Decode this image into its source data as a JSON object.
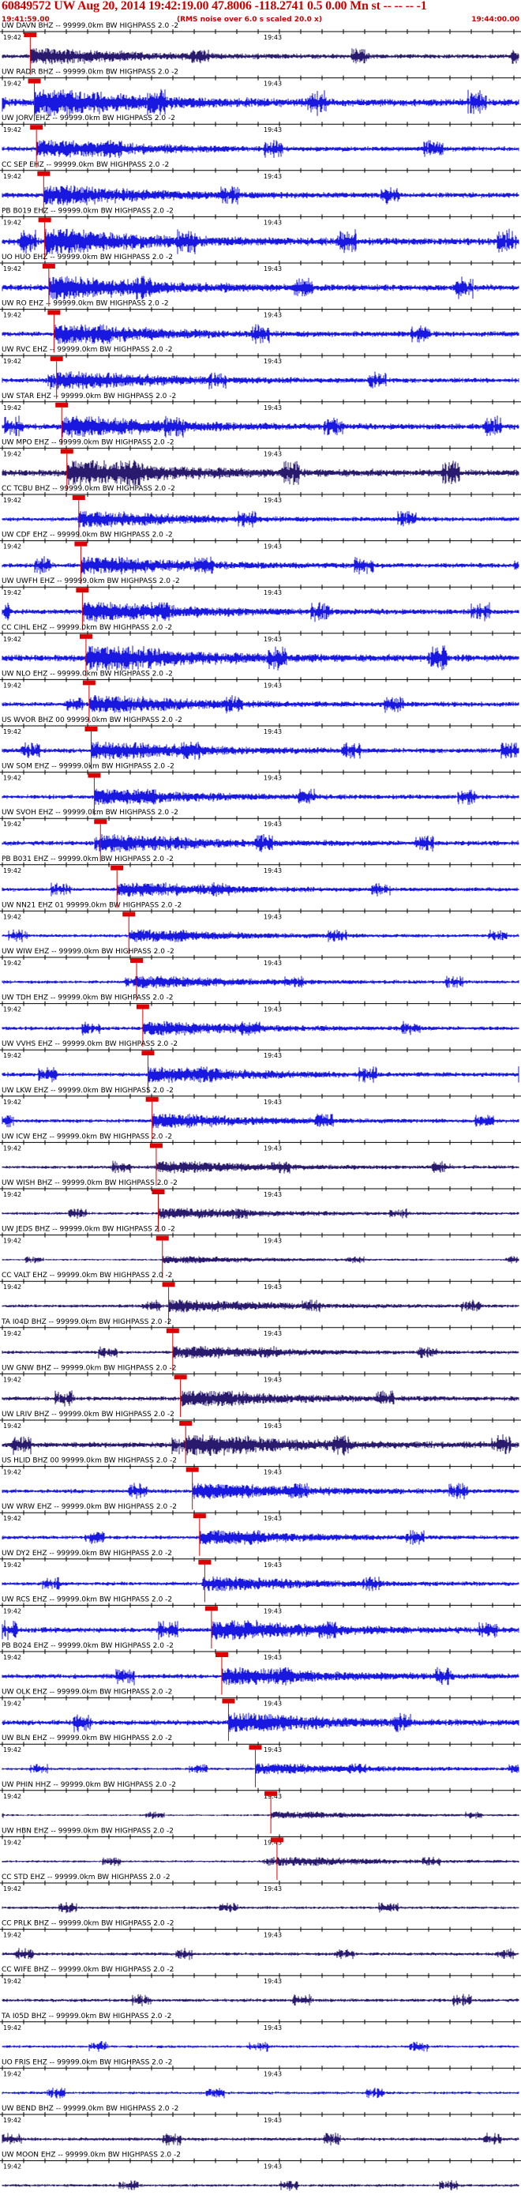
{
  "header": {
    "title": "60849572 UW Aug 20, 2014 19:42:19.00   47.8006 -118.2741  0.5 0.00 Mn st -- -- --  -1",
    "start_time": "19:41:59.00",
    "note": "(RMS noise over 6.0 s scaled 20.0 x)",
    "end_time": "19:44:00.00"
  },
  "time_labels": {
    "left": "19:42",
    "mid": "19:43"
  },
  "colors": {
    "trace_blue": "#1818e0",
    "trace_dark": "#2a1a6e",
    "pick_red": "#dd0000",
    "axis": "#000000"
  },
  "stations": [
    {
      "label": "UW DAVN BHZ -- 99999.0km BW  HIGHPASS  2.0 -2",
      "pick": 0.054,
      "amp": 0.45,
      "dark": true
    },
    {
      "label": "UW RADR BHZ -- 99999.0km BW  HIGHPASS  2.0 -2",
      "pick": 0.062,
      "amp": 0.75,
      "dark": false
    },
    {
      "label": "UW JORV EHZ -- 99999.0km BW  HIGHPASS  2.0 -2",
      "pick": 0.066,
      "amp": 0.5,
      "dark": false
    },
    {
      "label": "CC SEP EHZ -- 99999.0km BW  HIGHPASS  2.0 -2",
      "pick": 0.08,
      "amp": 0.55,
      "dark": false
    },
    {
      "label": "PB B019 EHZ -- 99999.0km BW  HIGHPASS  2.0 -2",
      "pick": 0.082,
      "amp": 0.7,
      "dark": false
    },
    {
      "label": "UO HUO EHZ -- 99999.0km BW  HIGHPASS  2.0 -2",
      "pick": 0.09,
      "amp": 0.65,
      "dark": false
    },
    {
      "label": "UW RO EHZ -- 99999.0km BW  HIGHPASS  2.0 -2",
      "pick": 0.1,
      "amp": 0.55,
      "dark": false
    },
    {
      "label": "UW RVC EHZ -- 99999.0km BW  HIGHPASS  2.0 -2",
      "pick": 0.105,
      "amp": 0.5,
      "dark": false
    },
    {
      "label": "UW STAR EHZ -- 99999.0km BW  HIGHPASS  2.0 -2",
      "pick": 0.115,
      "amp": 0.6,
      "dark": false
    },
    {
      "label": "UW MPO EHZ -- 99999.0km BW  HIGHPASS  2.0 -2",
      "pick": 0.125,
      "amp": 0.7,
      "dark": true
    },
    {
      "label": "CC TCBU BHZ -- 99999.0km BW  HIGHPASS  2.0 -2",
      "pick": 0.148,
      "amp": 0.45,
      "dark": false
    },
    {
      "label": "UW CDF EHZ -- 99999.0km BW  HIGHPASS  2.0 -2",
      "pick": 0.152,
      "amp": 0.5,
      "dark": false
    },
    {
      "label": "UW UWFH EHZ -- 99999.0km BW  HIGHPASS  2.0 -2",
      "pick": 0.155,
      "amp": 0.55,
      "dark": false
    },
    {
      "label": "CC CIHL EHZ -- 99999.0km BW  HIGHPASS  2.0 -2",
      "pick": 0.162,
      "amp": 0.7,
      "dark": false
    },
    {
      "label": "UW NLO EHZ -- 99999.0km BW  HIGHPASS  2.0 -2",
      "pick": 0.168,
      "amp": 0.5,
      "dark": false
    },
    {
      "label": "US WVOR BHZ 00 99999.0km BW  HIGHPASS  2.0 -2",
      "pick": 0.172,
      "amp": 0.5,
      "dark": false
    },
    {
      "label": "UW SOM EHZ -- 99999.0km BW  HIGHPASS  2.0 -2",
      "pick": 0.178,
      "amp": 0.45,
      "dark": false
    },
    {
      "label": "UW SVOH EHZ -- 99999.0km BW  HIGHPASS  2.0 -2",
      "pick": 0.19,
      "amp": 0.5,
      "dark": false
    },
    {
      "label": "PB B031 EHZ -- 99999.0km BW  HIGHPASS  2.0 -2",
      "pick": 0.222,
      "amp": 0.4,
      "dark": false
    },
    {
      "label": "UW NN21 EHZ 01 99999.0km BW  HIGHPASS  2.0 -2",
      "pick": 0.245,
      "amp": 0.35,
      "dark": false
    },
    {
      "label": "UW WIW EHZ -- 99999.0km BW  HIGHPASS  2.0 -2",
      "pick": 0.26,
      "amp": 0.35,
      "dark": false
    },
    {
      "label": "UW TDH EHZ -- 99999.0km BW  HIGHPASS  2.0 -2",
      "pick": 0.272,
      "amp": 0.4,
      "dark": false
    },
    {
      "label": "UW VVHS EHZ -- 99999.0km BW  HIGHPASS  2.0 -2",
      "pick": 0.282,
      "amp": 0.45,
      "dark": false
    },
    {
      "label": "UW LKW EHZ -- 99999.0km BW  HIGHPASS  2.0 -2",
      "pick": 0.29,
      "amp": 0.4,
      "dark": false
    },
    {
      "label": "UW ICW EHZ -- 99999.0km BW  HIGHPASS  2.0 -2",
      "pick": 0.298,
      "amp": 0.35,
      "dark": true
    },
    {
      "label": "UW WISH BHZ -- 99999.0km BW  HIGHPASS  2.0 -2",
      "pick": 0.302,
      "amp": 0.3,
      "dark": true
    },
    {
      "label": "UW JEDS BHZ -- 99999.0km BW  HIGHPASS  2.0 -2",
      "pick": 0.31,
      "amp": 0.2,
      "dark": true
    },
    {
      "label": "CC VALT EHZ -- 99999.0km BW  HIGHPASS  2.0 -2",
      "pick": 0.322,
      "amp": 0.35,
      "dark": true
    },
    {
      "label": "TA I04D BHZ -- 99999.0km BW  HIGHPASS  2.0 -2",
      "pick": 0.33,
      "amp": 0.35,
      "dark": true
    },
    {
      "label": "UW GNW BHZ -- 99999.0km BW  HIGHPASS  2.0 -2",
      "pick": 0.345,
      "amp": 0.45,
      "dark": true
    },
    {
      "label": "UW LRIV BHZ -- 99999.0km BW  HIGHPASS  2.0 -2",
      "pick": 0.355,
      "amp": 0.6,
      "dark": true
    },
    {
      "label": "US HLID BHZ 00 99999.0km BW  HIGHPASS  2.0 -2",
      "pick": 0.368,
      "amp": 0.45,
      "dark": false
    },
    {
      "label": "UW WRW EHZ -- 99999.0km BW  HIGHPASS  2.0 -2",
      "pick": 0.382,
      "amp": 0.4,
      "dark": false
    },
    {
      "label": "UW DY2 EHZ -- 99999.0km BW  HIGHPASS  2.0 -2",
      "pick": 0.392,
      "amp": 0.4,
      "dark": false
    },
    {
      "label": "UW RCS EHZ -- 99999.0km BW  HIGHPASS  2.0 -2",
      "pick": 0.405,
      "amp": 0.55,
      "dark": false
    },
    {
      "label": "PB B024 EHZ -- 99999.0km BW  HIGHPASS  2.0 -2",
      "pick": 0.425,
      "amp": 0.5,
      "dark": false
    },
    {
      "label": "UW OLK EHZ -- 99999.0km BW  HIGHPASS  2.0 -2",
      "pick": 0.438,
      "amp": 0.55,
      "dark": false
    },
    {
      "label": "UW BLN EHZ -- 99999.0km BW  HIGHPASS  2.0 -2",
      "pick": 0.49,
      "amp": 0.3,
      "dark": false
    },
    {
      "label": "UW PHIN HHZ -- 99999.0km BW  HIGHPASS  2.0 -2",
      "pick": 0.52,
      "amp": 0.2,
      "dark": true
    },
    {
      "label": "UW HBN EHZ -- 99999.0km BW  HIGHPASS  2.0 -2",
      "pick": 0.532,
      "amp": 0.25,
      "dark": true
    },
    {
      "label": "CC STD EHZ -- 99999.0km BW  HIGHPASS  2.0 -2",
      "pick": null,
      "amp": 0.3,
      "dark": true
    },
    {
      "label": "CC PRLK BHZ -- 99999.0km BW  HIGHPASS  2.0 -2",
      "pick": null,
      "amp": 0.35,
      "dark": true
    },
    {
      "label": "CC WIFE BHZ -- 99999.0km BW  HIGHPASS  2.0 -2",
      "pick": null,
      "amp": 0.35,
      "dark": true
    },
    {
      "label": "TA I05D BHZ -- 99999.0km BW  HIGHPASS  2.0 -2",
      "pick": null,
      "amp": 0.3,
      "dark": false
    },
    {
      "label": "UO FRIS EHZ -- 99999.0km BW  HIGHPASS  2.0 -2",
      "pick": null,
      "amp": 0.3,
      "dark": false
    },
    {
      "label": "UW BEND BHZ -- 99999.0km BW  HIGHPASS  2.0 -2",
      "pick": null,
      "amp": 0.35,
      "dark": true
    },
    {
      "label": "UW MOON EHZ -- 99999.0km BW  HIGHPASS  2.0 -2",
      "pick": null,
      "amp": 0.3,
      "dark": true
    }
  ]
}
